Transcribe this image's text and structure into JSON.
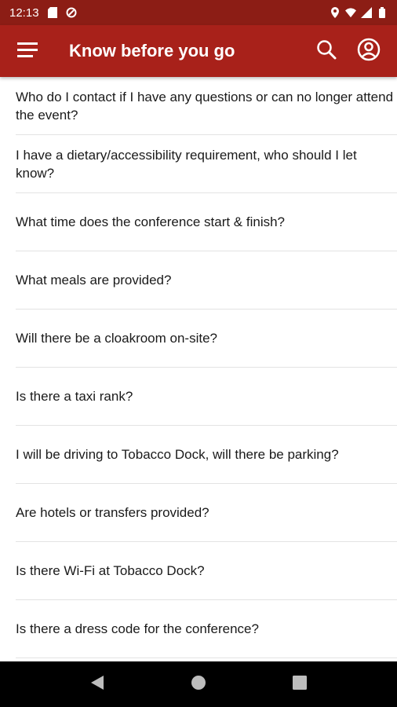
{
  "status_bar": {
    "time": "12:13",
    "icons": [
      "sd-card-icon",
      "data-saver-icon",
      "location-icon",
      "wifi-icon",
      "signal-icon",
      "battery-icon"
    ]
  },
  "app_bar": {
    "title": "Know before you go",
    "color": "#a8211a",
    "status_color": "#8c1d15",
    "icons": [
      "menu-icon",
      "search-icon",
      "account-icon"
    ]
  },
  "faq": [
    {
      "question": "Who do I contact if I have any questions or can no longer attend the event?"
    },
    {
      "question": "I have a dietary/accessibility requirement, who should I let know?"
    },
    {
      "question": "What time does the conference start & finish?"
    },
    {
      "question": "What meals are provided?"
    },
    {
      "question": "Will there be a cloakroom on-site?"
    },
    {
      "question": "Is there a taxi rank?"
    },
    {
      "question": "I will be driving to Tobacco Dock, will there be parking?"
    },
    {
      "question": "Are hotels or transfers provided?"
    },
    {
      "question": "Is there Wi-Fi at Tobacco Dock?"
    },
    {
      "question": "Is there a dress code for the conference?"
    }
  ],
  "nav_bar": {
    "icons": [
      "back-icon",
      "home-icon",
      "recents-icon"
    ]
  }
}
